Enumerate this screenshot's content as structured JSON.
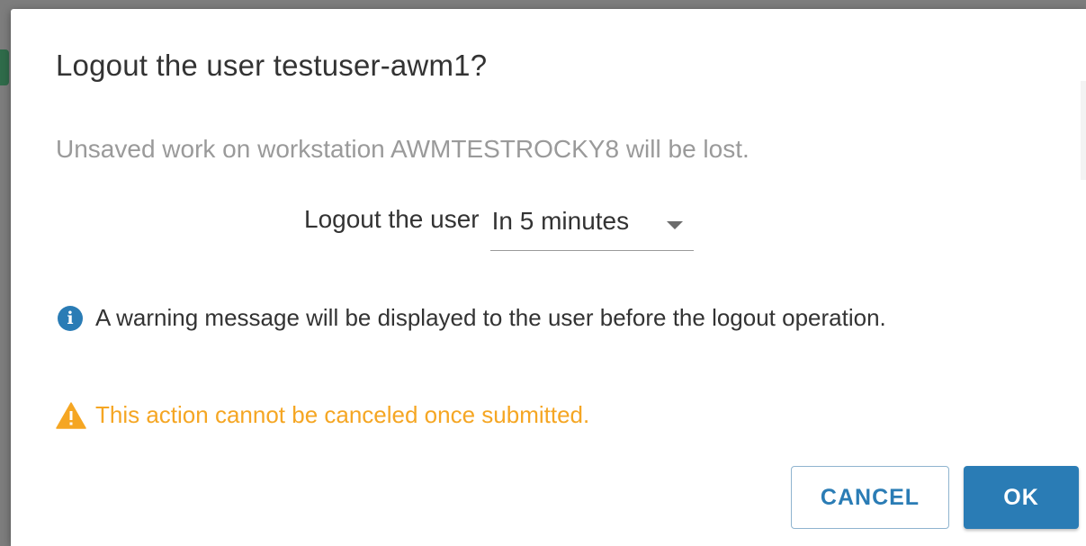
{
  "dialog": {
    "title": "Logout the user testuser-awm1?",
    "subtitle": "Unsaved work on workstation AWMTESTROCKY8 will be lost.",
    "logout_label": "Logout the user",
    "logout_select": {
      "selected": "In 5 minutes"
    },
    "info_message": "A warning message will be displayed to the user before the logout operation.",
    "warning_message": "This action cannot be canceled once submitted.",
    "buttons": {
      "cancel_label": "CANCEL",
      "ok_label": "OK"
    }
  },
  "icons": {
    "info": "info-circle-icon",
    "warning": "warning-triangle-icon",
    "dropdown": "caret-down-icon"
  },
  "colors": {
    "accent": "#2a7cb5",
    "warning": "#f5a623",
    "title_text": "#333333",
    "muted_text": "#9a9a9a"
  }
}
